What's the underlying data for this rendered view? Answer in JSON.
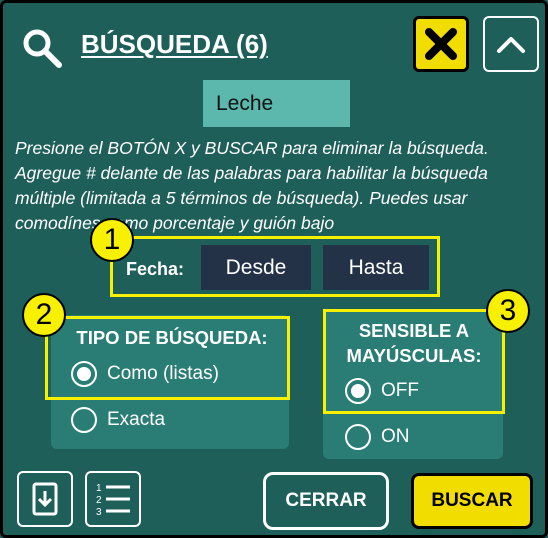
{
  "header": {
    "title": "BÚSQUEDA (6)"
  },
  "search": {
    "value": "Leche"
  },
  "help_text": "Presione el BOTÓN X y BUSCAR para eliminar la búsqueda. Agregue # delante de las palabras para habilitar la búsqueda múltiple (limitada a 5 términos de búsqueda). Puedes usar comodínes como porcentaje y guión bajo",
  "date_filter": {
    "label": "Fecha:",
    "from_label": "Desde",
    "to_label": "Hasta"
  },
  "search_type": {
    "title": "TIPO DE BÚSQUEDA:",
    "options": [
      "Como (listas)",
      "Exacta"
    ],
    "selected": "Como (listas)"
  },
  "case_sensitive": {
    "title_line1": "SENSIBLE A",
    "title_line2": "MAYÚSCULAS:",
    "options": [
      "OFF",
      "ON"
    ],
    "selected": "OFF"
  },
  "badges": [
    "1",
    "2",
    "3"
  ],
  "footer": {
    "cancel_label": "CERRAR",
    "search_label": "BUSCAR"
  },
  "icons": {
    "search": "search-icon",
    "close": "close-x-icon",
    "collapse": "chevron-up-icon",
    "download": "download-icon",
    "list": "numbered-list-icon"
  },
  "colors": {
    "background": "#1f5f5a",
    "panel": "#2a7d74",
    "input": "#5cb8ad",
    "highlight": "#f7f000",
    "accent_button": "#f2dd00",
    "date_button": "#233247"
  }
}
